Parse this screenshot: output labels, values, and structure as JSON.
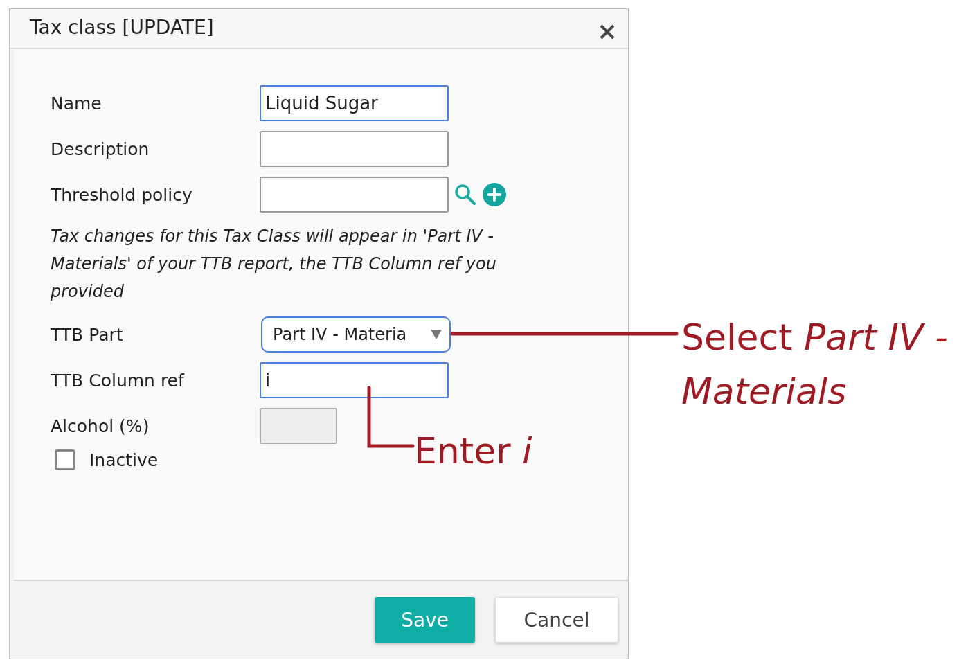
{
  "dialog": {
    "title": "Tax class [UPDATE]"
  },
  "fields": [
    {
      "label": "Name",
      "kind": "text",
      "value": "Liquid Sugar",
      "focused": true
    },
    {
      "label": "Description",
      "kind": "text",
      "focused": false
    },
    {
      "label": "Threshold policy",
      "kind": "lookup",
      "focused": false
    },
    {
      "kind": "note",
      "text": "Tax changes for this Tax Class will appear in 'Part IV - Materials' of your TTB report, the TTB Column ref you provided"
    },
    {
      "label": "TTB Part",
      "kind": "select",
      "value": "Part IV - Materia",
      "focused": true
    },
    {
      "label": "TTB Column ref",
      "kind": "text",
      "value": "i",
      "focused": true
    },
    {
      "label": "Alcohol (%)",
      "kind": "short",
      "disabled": true,
      "focused": false
    },
    {
      "label": "Inactive",
      "kind": "checkbox",
      "checked": false
    }
  ],
  "buttons": [
    {
      "label": "Save",
      "kind": "primary"
    },
    {
      "label": "Cancel",
      "kind": "secondary"
    }
  ],
  "annotations": [
    {
      "kind": "select",
      "text": "Select *Part IV - Materials*"
    },
    {
      "kind": "enter",
      "text": "Enter *i*"
    }
  ]
}
